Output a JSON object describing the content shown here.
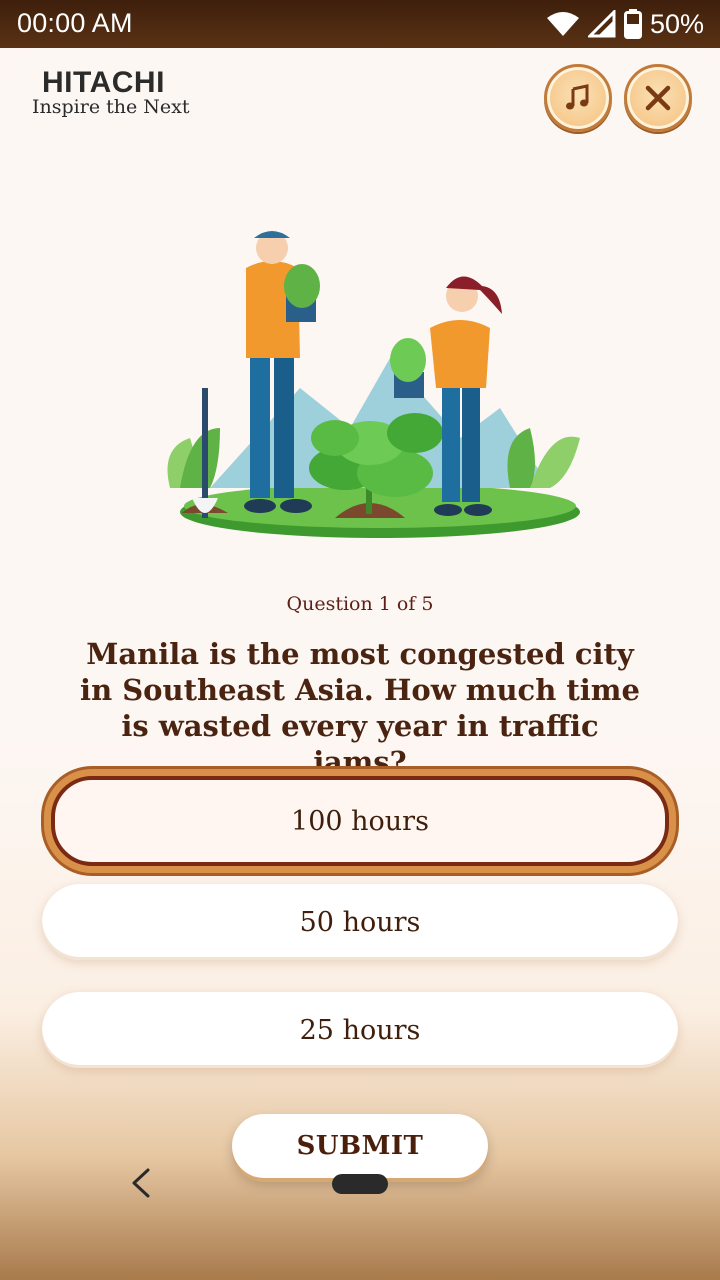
{
  "status_bar": {
    "time": "00:00 AM",
    "battery": "50%"
  },
  "brand": {
    "name": "HITACHI",
    "tagline": "Inspire the Next"
  },
  "header": {
    "music_icon": "music-note-icon",
    "close_icon": "close-x-icon"
  },
  "quiz": {
    "progress": "Question 1 of 5",
    "question": "Manila is the most congested city in Southeast Asia. How much time is wasted every year in traffic jams?",
    "options": [
      {
        "label": "100 hours",
        "selected": true
      },
      {
        "label": "50 hours",
        "selected": false
      },
      {
        "label": "25 hours",
        "selected": false
      }
    ],
    "submit_label": "SUBMIT"
  },
  "colors": {
    "accent_brown": "#4a2410",
    "status_bar": "#4a2812",
    "option_border": "#7a2a12",
    "button_gold": "#f6c98c"
  }
}
